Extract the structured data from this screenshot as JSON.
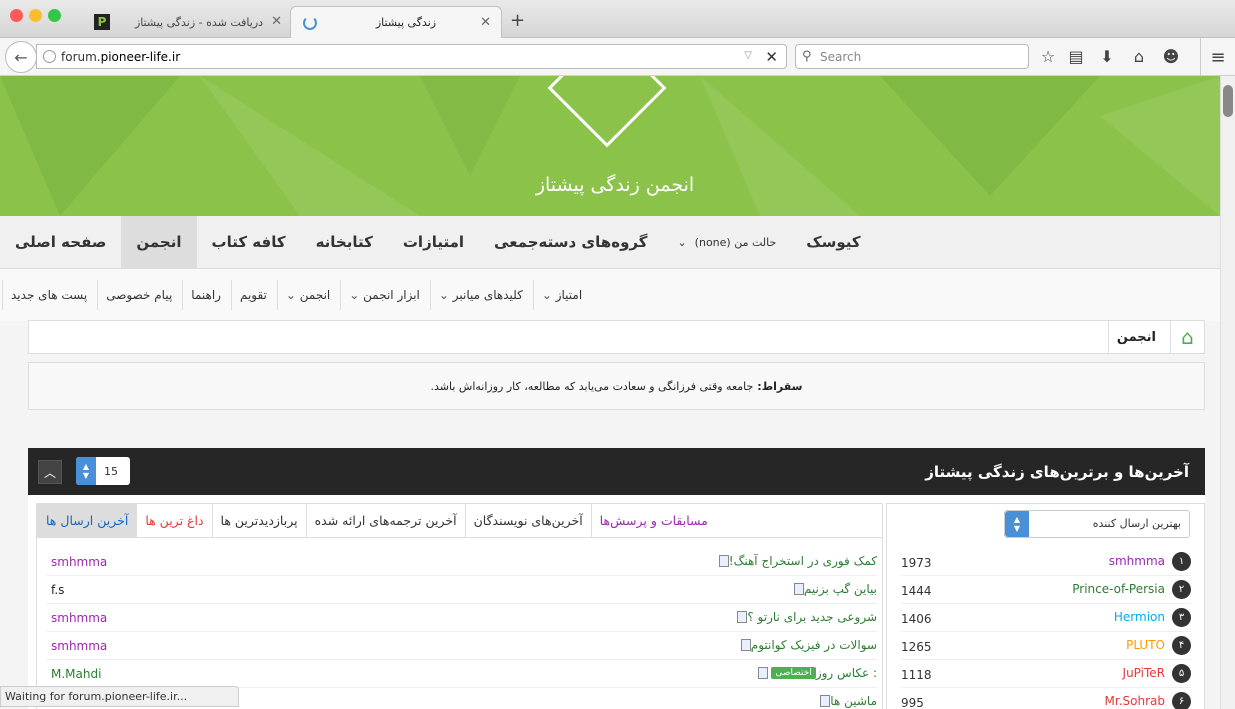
{
  "browser": {
    "tabs": [
      {
        "title": "دریافت شده - زندگی پیشتاز",
        "favicon": "P"
      },
      {
        "title": "زندگی پیشتاز"
      }
    ],
    "url_prefix": "forum.",
    "url_domain": "pioneer-life.ir",
    "search_placeholder": "Search",
    "status": "Waiting for forum.pioneer-life.ir..."
  },
  "banner": {
    "logo_text": "انجمن زندگی پیشتاز"
  },
  "main_nav": [
    {
      "label": "صفحه اصلی"
    },
    {
      "label": "انجمن"
    },
    {
      "label": "کافه کتاب"
    },
    {
      "label": "کتابخانه"
    },
    {
      "label": "امتیازات"
    },
    {
      "label": "گروه‌های دسته‌جمعی"
    },
    {
      "label": "حالت من (none)"
    },
    {
      "label": "کیوسک"
    }
  ],
  "sub_nav": [
    {
      "label": "پست های جدید"
    },
    {
      "label": "پیام خصوصی"
    },
    {
      "label": "راهنما"
    },
    {
      "label": "تقویم"
    },
    {
      "label": "انجمن"
    },
    {
      "label": "ابزار انجمن"
    },
    {
      "label": "کلیدهای میانبر"
    },
    {
      "label": "امتیاز"
    }
  ],
  "breadcrumb": {
    "label": "انجمن"
  },
  "quote": {
    "author": "سقراط:",
    "text": "جامعه وقتی فرزانگی و سعادت می‌یابد که مطالعه، کار روزانه‌اش باشد."
  },
  "panel": {
    "title": "آخرین‌ها و برترین‌های زندگی پیشتاز",
    "count": "15",
    "tabs": [
      {
        "label": "آخرین ارسال ها"
      },
      {
        "label": "داغ ترین ها"
      },
      {
        "label": "پربازدیدترین ها"
      },
      {
        "label": "آخرین ترجمه‌های ارائه شده"
      },
      {
        "label": "آخرین‌های نویسندگان"
      },
      {
        "label": "مسابقات و پرسش‌ها"
      }
    ],
    "topics": [
      {
        "title": "کمک فوری در استخراج آهنگ!",
        "user": "smhmma",
        "user_color": "#9c27b0"
      },
      {
        "title": "بیاین گپ بزنیم",
        "user": "f.s",
        "user_color": "#222222"
      },
      {
        "title": "شروعی جدید برای نارتو ؟",
        "user": "smhmma",
        "user_color": "#9c27b0"
      },
      {
        "title": "سوالات در فیزیک کوانتوم",
        "user": "smhmma",
        "user_color": "#9c27b0"
      },
      {
        "title": ": عکاس روز",
        "tag": "اختصاصی",
        "user": "M.Mahdi",
        "user_color": "#2e7d32"
      },
      {
        "title": "ماشین ها",
        "user": "",
        "user_color": "#222222"
      }
    ],
    "top_posters_label": "بهترین ارسال کننده",
    "top_posters": [
      {
        "rank": "۱",
        "name": "smhmma",
        "count": "1973",
        "color": "#9c27b0"
      },
      {
        "rank": "۲",
        "name": "Prince-of-Persia",
        "count": "1444",
        "color": "#2e7d32"
      },
      {
        "rank": "۳",
        "name": "Hermion",
        "count": "1406",
        "color": "#03a9f4"
      },
      {
        "rank": "۴",
        "name": "PLUTO",
        "count": "1265",
        "color": "#ff9800"
      },
      {
        "rank": "۵",
        "name": "JuPiTeR",
        "count": "1118",
        "color": "#e53935"
      },
      {
        "rank": "۶",
        "name": "Mr.Sohrab",
        "count": "995",
        "color": "#e53935"
      }
    ]
  }
}
